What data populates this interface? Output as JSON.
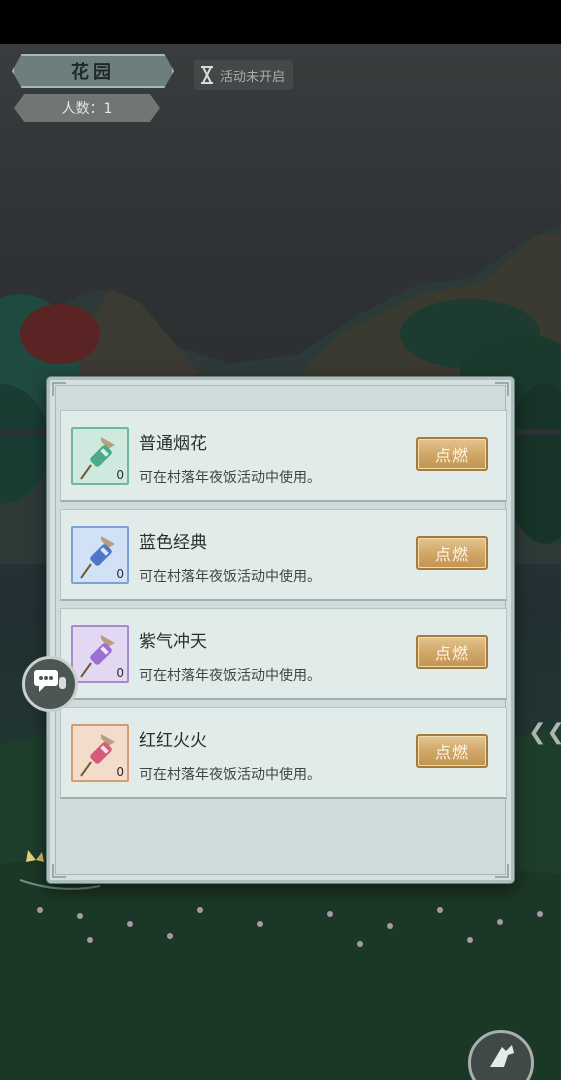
{
  "header": {
    "area_title": "花园",
    "player_count": "人数：1",
    "event_status": "活动未开启"
  },
  "colors": {
    "green_frame": "#6db89a",
    "blue_frame": "#7ba2d8",
    "purple_frame": "#a78ccc",
    "red_frame": "#d79a72",
    "button_gold": "#cfa566"
  },
  "icons": {
    "chat": "chat-bubble-icon",
    "status": "hourglass-icon",
    "corner": "action-icon",
    "side": "double-chevron-left-icon"
  },
  "fireworks": [
    {
      "name": "普通烟花",
      "count": "0",
      "description": "可在村落年夜饭活动中使用。",
      "button": "点燃",
      "rarity": "green"
    },
    {
      "name": "蓝色经典",
      "count": "0",
      "description": "可在村落年夜饭活动中使用。",
      "button": "点燃",
      "rarity": "blue"
    },
    {
      "name": "紫气冲天",
      "count": "0",
      "description": "可在村落年夜饭活动中使用。",
      "button": "点燃",
      "rarity": "purple"
    },
    {
      "name": "红红火火",
      "count": "0",
      "description": "可在村落年夜饭活动中使用。",
      "button": "点燃",
      "rarity": "red"
    }
  ]
}
